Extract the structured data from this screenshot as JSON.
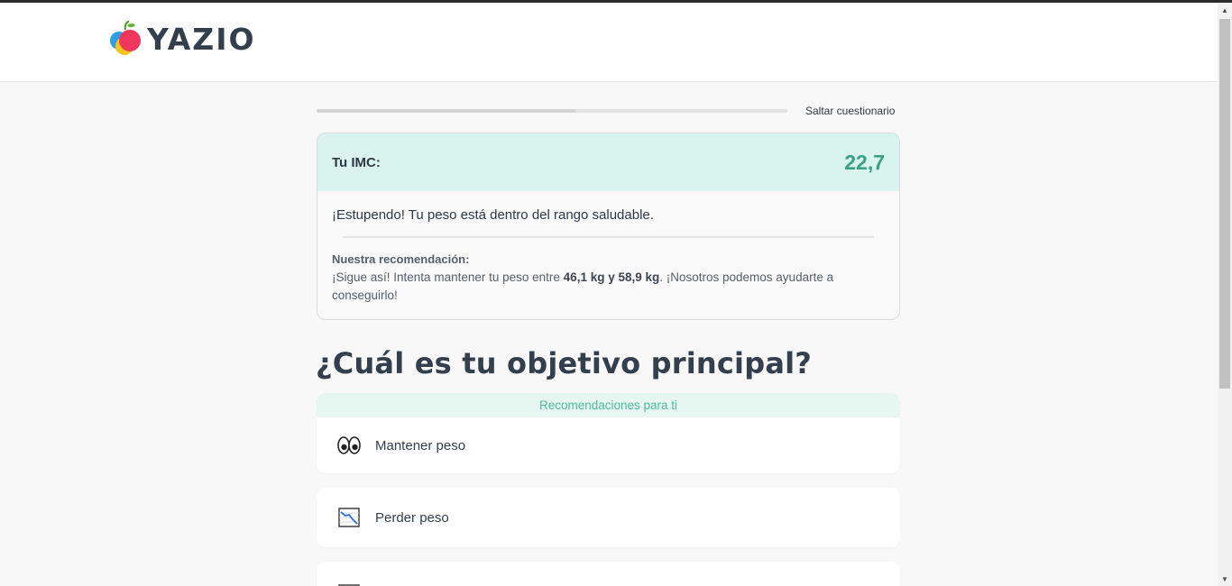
{
  "header": {
    "brand": "YAZIO",
    "logo_icon": "apple-logo-icon"
  },
  "progress": {
    "fraction": 0.55,
    "skip_label": "Saltar cuestionario"
  },
  "bmi": {
    "label": "Tu IMC:",
    "value": "22,7",
    "message": "¡Estupendo! Tu peso está dentro del rango saludable.",
    "recommendation_title": "Nuestra recomendación:",
    "recommendation_before": "¡Sigue así! Intenta mantener tu peso entre ",
    "recommendation_bold": "46,1 kg y 58,9 kg",
    "recommendation_after": ". ¡Nosotros podemos ayudarte a conseguirlo!"
  },
  "question": "¿Cuál es tu objetivo principal?",
  "options": [
    {
      "recommendation": "Recomendaciones para ti",
      "icon": "eyes-icon",
      "label": "Mantener peso"
    },
    {
      "icon": "chart-decreasing-icon",
      "label": "Perder peso"
    },
    {
      "icon": "chart-icon",
      "label": ""
    }
  ],
  "colors": {
    "accent": "#3a9f86",
    "bmi_header_bg": "#d9f3ee",
    "recommend_text": "#4fbb9b",
    "text": "#2f3845"
  }
}
